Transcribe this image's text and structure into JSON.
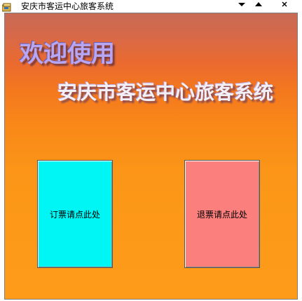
{
  "window": {
    "title": "安庆市客运中心旅客系统",
    "controls": {
      "minimize_glyph": "▾",
      "maximize_glyph": "▴",
      "close_glyph": "×"
    }
  },
  "banner": {
    "welcome": "欢迎使用",
    "system_name": "安庆市客运中心旅客系统"
  },
  "buttons": {
    "book_label": "订票请点此处",
    "refund_label": "退票请点此处"
  },
  "colors": {
    "book_button": "#00f5f5",
    "refund_button": "#fb7f7d",
    "background_top": "#c76a55",
    "background_bottom": "#fe9c1a"
  }
}
